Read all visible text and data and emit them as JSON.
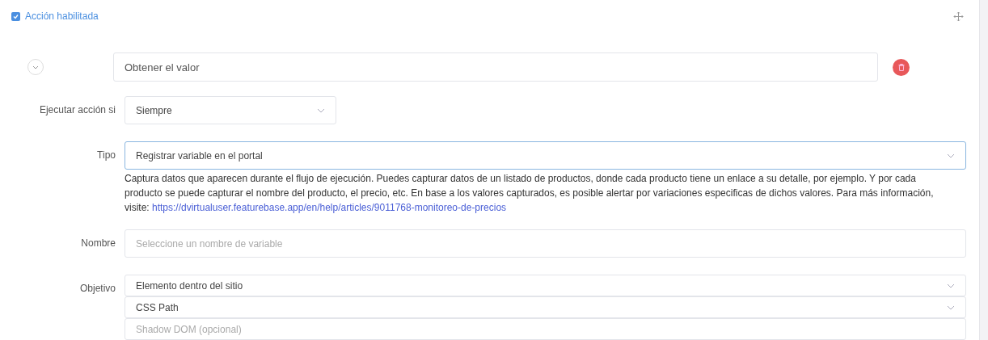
{
  "action_enabled": {
    "label": "Acción habilitada",
    "checked": true
  },
  "action": {
    "name": "Obtener el valor",
    "expanded": false
  },
  "rows": [
    {
      "label": "Ejecutar acción si",
      "controls": [
        {
          "kind": "short-select",
          "value": "Siempre",
          "focused": false
        }
      ]
    },
    {
      "label": "Tipo",
      "controls": [
        {
          "kind": "select",
          "value": "Registrar variable en el portal",
          "focused": true
        }
      ],
      "help": {
        "text": "Captura datos que aparecen durante el flujo de ejecución. Puedes capturar datos de un listado de productos, donde cada producto tiene un enlace a su detalle, por ejemplo. Y por cada producto se puede capturar el nombre del producto, el precio, etc. En base a los valores capturados, es posible alertar por variaciones especificas de dichos valores. Para más información, visite: ",
        "link": "https://dvirtualuser.featurebase.app/en/help/articles/9011768-monitoreo-de-precios"
      }
    },
    {
      "label": "Nombre",
      "controls": [
        {
          "kind": "input",
          "placeholder": "Seleccione un nombre de variable"
        }
      ]
    },
    {
      "label": "Objetivo",
      "controls": [
        {
          "kind": "select",
          "value": "Elemento dentro del sitio",
          "focused": false
        },
        {
          "kind": "select",
          "value": "CSS Path",
          "focused": false
        },
        {
          "kind": "input",
          "placeholder": "Shadow DOM (opcional)"
        }
      ]
    }
  ]
}
